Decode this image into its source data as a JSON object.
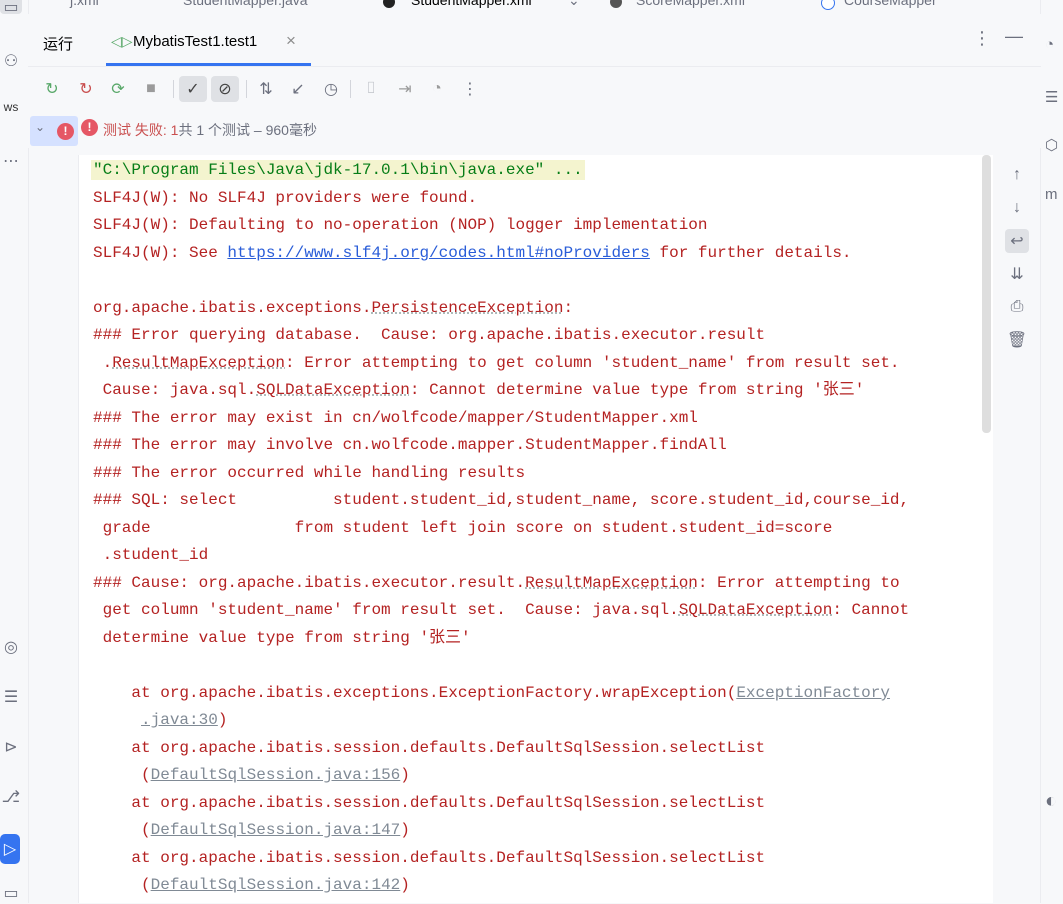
{
  "editor_tabs": [
    {
      "label": "j.xml"
    },
    {
      "label": "StudentMapper.java"
    },
    {
      "label": "StudentMapper.xml"
    },
    {
      "label": "ScoreMapper.xml"
    },
    {
      "label": "CourseMapper"
    }
  ],
  "left_stripe": {
    "aws_label": "ws"
  },
  "run_window": {
    "title": "运行",
    "tab_label": "MybatisTest1.test1",
    "more_icon": "⋮",
    "hide_icon": "—"
  },
  "test_status": {
    "prefix": "测试 ",
    "failed": "失败: ",
    "count": "1",
    "summary": "共 1 个测试 – 960毫秒"
  },
  "console": {
    "command_line": "\"C:\\Program Files\\Java\\jdk-17.0.1\\bin\\java.exe\" ...",
    "slf4j_1": "SLF4J(W): No SLF4J providers were found.",
    "slf4j_2": "SLF4J(W): Defaulting to no-operation (NOP) logger implementation",
    "slf4j_3_prefix": "SLF4J(W): See ",
    "slf4j_3_link": "https://www.slf4j.org/codes.html#noProviders",
    "slf4j_3_suffix": " for further details.",
    "exc_prefix": "org.apache.ibatis.exceptions.",
    "exc_class": "PersistenceException",
    "exc_suffix": ":",
    "err1": "### Error querying database.  Cause: org.apache.ibatis.executor.result",
    "err2_prefix": " .",
    "err2_class": "ResultMapException",
    "err2_suffix": ": Error attempting to get column 'student_name' from result set.",
    "err3_prefix": " Cause: java.sql.",
    "err3_class": "SQLDataException",
    "err3_suffix": ": Cannot determine value type from string '张三'",
    "err4": "### The error may exist in cn/wolfcode/mapper/StudentMapper.xml",
    "err5": "### The error may involve cn.wolfcode.mapper.StudentMapper.findAll",
    "err6": "### The error occurred while handling results",
    "sql1": "### SQL: select          student.student_id,student_name, score.student_id,course_id,",
    "sql2": " grade               from student left join score on student.student_id=score",
    "sql3": " .student_id",
    "cause1_prefix": "### Cause: org.apache.ibatis.executor.result.",
    "cause1_class": "ResultMapException",
    "cause1_suffix": ": Error attempting to",
    "cause2_prefix": " get column 'student_name' from result set.  Cause: java.sql.",
    "cause2_class": "SQLDataException",
    "cause2_suffix": ": Cannot",
    "cause3": " determine value type from string '张三'",
    "trace": [
      {
        "text": "    at org.apache.ibatis.exceptions.ExceptionFactory.wrapException(",
        "link": "ExceptionFactory",
        "cont_link": ".java:30",
        "cont_suffix": ")"
      },
      {
        "text": "    at org.apache.ibatis.session.defaults.DefaultSqlSession.selectList",
        "cont_prefix": "(",
        "cont_link": "DefaultSqlSession.java:156",
        "cont_suffix": ")"
      },
      {
        "text": "    at org.apache.ibatis.session.defaults.DefaultSqlSession.selectList",
        "cont_prefix": "(",
        "cont_link": "DefaultSqlSession.java:147",
        "cont_suffix": ")"
      },
      {
        "text": "    at org.apache.ibatis.session.defaults.DefaultSqlSession.selectList",
        "cont_prefix": "(",
        "cont_link": "DefaultSqlSession.java:142",
        "cont_suffix": ")"
      }
    ]
  },
  "colors": {
    "error_text": "#b42222",
    "link": "#2a5dd8",
    "accent": "#3574f0",
    "error_badge": "#e55765"
  }
}
